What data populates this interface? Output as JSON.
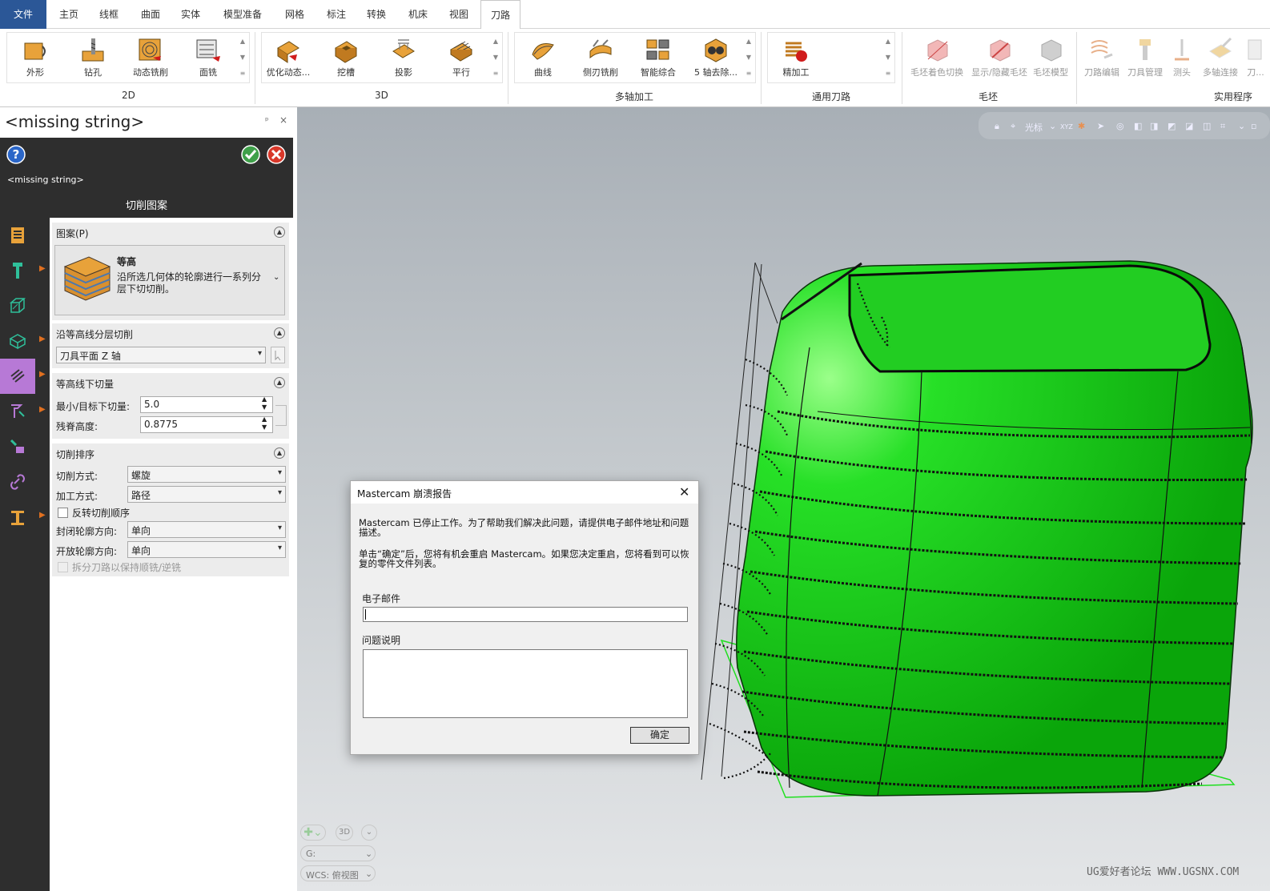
{
  "menu": {
    "file": "文件",
    "tabs": [
      "主页",
      "线框",
      "曲面",
      "实体",
      "模型准备",
      "网格",
      "标注",
      "转换",
      "机床",
      "视图",
      "刀路"
    ],
    "active_tab": "刀路"
  },
  "ribbon": {
    "groups": [
      "2D",
      "3D",
      "多轴加工",
      "通用刀路",
      "毛坯",
      "实用程序"
    ],
    "buttons_2d": [
      "外形",
      "钻孔",
      "动态铣削",
      "面铣"
    ],
    "buttons_3d": [
      "优化动态...",
      "挖槽",
      "投影",
      "平行"
    ],
    "buttons_multiaxis": [
      "曲线",
      "侧刃铣削",
      "智能综合",
      "5 轴去除..."
    ],
    "buttons_general": [
      "精加工"
    ],
    "buttons_stock": [
      "毛坯着色切换",
      "显示/隐藏毛坯",
      "毛坯模型"
    ],
    "buttons_util": [
      "刀路编辑",
      "刀具管理",
      "测头",
      "多轴连接",
      "刀..."
    ]
  },
  "panel": {
    "title": "<missing string>",
    "pin": "ᵖ",
    "close": "×",
    "subtitle": "<missing string>",
    "page_title": "切削图案"
  },
  "form": {
    "pattern": {
      "header": "图案(P)",
      "name": "等高",
      "desc": "沿所选几何体的轮廓进行一系列分层下切切削。"
    },
    "layer": {
      "header": "沿等高线分层切削",
      "axis": "刀具平面 Z 轴"
    },
    "stepdown": {
      "header": "等高线下切量",
      "min_label": "最小/目标下切量:",
      "min_value": "5.0",
      "scallop_label": "残脊高度:",
      "scallop_value": "0.8775"
    },
    "order": {
      "header": "切削排序",
      "cut_method_label": "切削方式:",
      "cut_method": "螺旋",
      "process_label": "加工方式:",
      "process": "路径",
      "reverse_label": "反转切削顺序",
      "closed_label": "封闭轮廓方向:",
      "closed": "单向",
      "open_label": "开放轮廓方向:",
      "open": "单向",
      "split_label": "拆分刀路以保持顺铣/逆铣"
    }
  },
  "dialog": {
    "title": "Mastercam 崩溃报告",
    "msg1": "Mastercam 已停止工作。为了帮助我们解决此问题，请提供电子邮件地址和问题描述。",
    "msg2": "单击“确定”后，您将有机会重启 Mastercam。如果您决定重启，您将看到可以恢复的零件文件列表。",
    "email_label": "电子邮件",
    "email_value": "",
    "problem_label": "问题说明",
    "problem_value": "",
    "ok": "确定"
  },
  "viewport": {
    "toolbar_label": "光标",
    "xyz": "XYZ",
    "view_3d": "3D",
    "g_label": "G:",
    "wcs_label": "WCS: 俯视图"
  },
  "watermark": "UG爱好者论坛 WWW.UGSNX.COM",
  "colors": {
    "part": "#16d716",
    "accent": "#2b5797",
    "active_tool": "#b779d6",
    "dark_panel": "#2e2e2e"
  }
}
